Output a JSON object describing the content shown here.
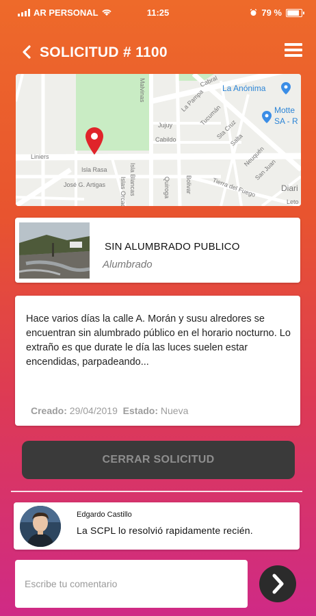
{
  "status_bar": {
    "carrier": "AR PERSONAL",
    "time": "11:25",
    "battery": "79 %"
  },
  "header": {
    "title": "SOLICITUD # 1100",
    "back_icon": "chevron-left-icon",
    "menu_icon": "hamburger-menu-icon"
  },
  "map": {
    "streets": [
      "Liniers",
      "Isla Rasa",
      "José G. Artigas",
      "Isla Blancas",
      "Islas Orcadas",
      "Jujuy",
      "Cabildo",
      "La Pampa",
      "Tucumán",
      "Sta Cruz",
      "Salta",
      "Neuquén",
      "San Juan",
      "Tierra del Fuego",
      "Bolivar",
      "Quiroga",
      "Cabral",
      "Malvinas",
      "Leto",
      "Diari"
    ],
    "places": [
      "La Anónima",
      "Motte",
      "SA - R"
    ],
    "pin_icon": "location-pin-icon",
    "colors": {
      "pin": "#e0242a",
      "park": "#c9ecc4",
      "road": "#ffffff"
    }
  },
  "category": {
    "title": "SIN ALUMBRADO PUBLICO",
    "subtitle": "Alumbrado"
  },
  "description": {
    "text": "Hace varios días la calle A. Morán y susu alredores se encuentran sin alumbrado público en el horario nocturno. Lo extraño es que durate le día las luces suelen estar encendidas, parpadeando...",
    "created_label": "Creado:",
    "created_value": "29/04/2019",
    "status_label": "Estado:",
    "status_value": "Nueva"
  },
  "close_button": {
    "label": "CERRAR SOLICITUD"
  },
  "comments": [
    {
      "author": "Edgardo Castillo",
      "text": "La SCPL lo resolvió rapidamente recién."
    }
  ],
  "comment_input": {
    "placeholder": "Escribe tu comentario",
    "value": ""
  },
  "send_icon": "chevron-right-icon",
  "colors": {
    "gradient_top": "#ee6a2a",
    "gradient_bottom": "#cf2a86",
    "button_dark": "#3a3a3a"
  }
}
